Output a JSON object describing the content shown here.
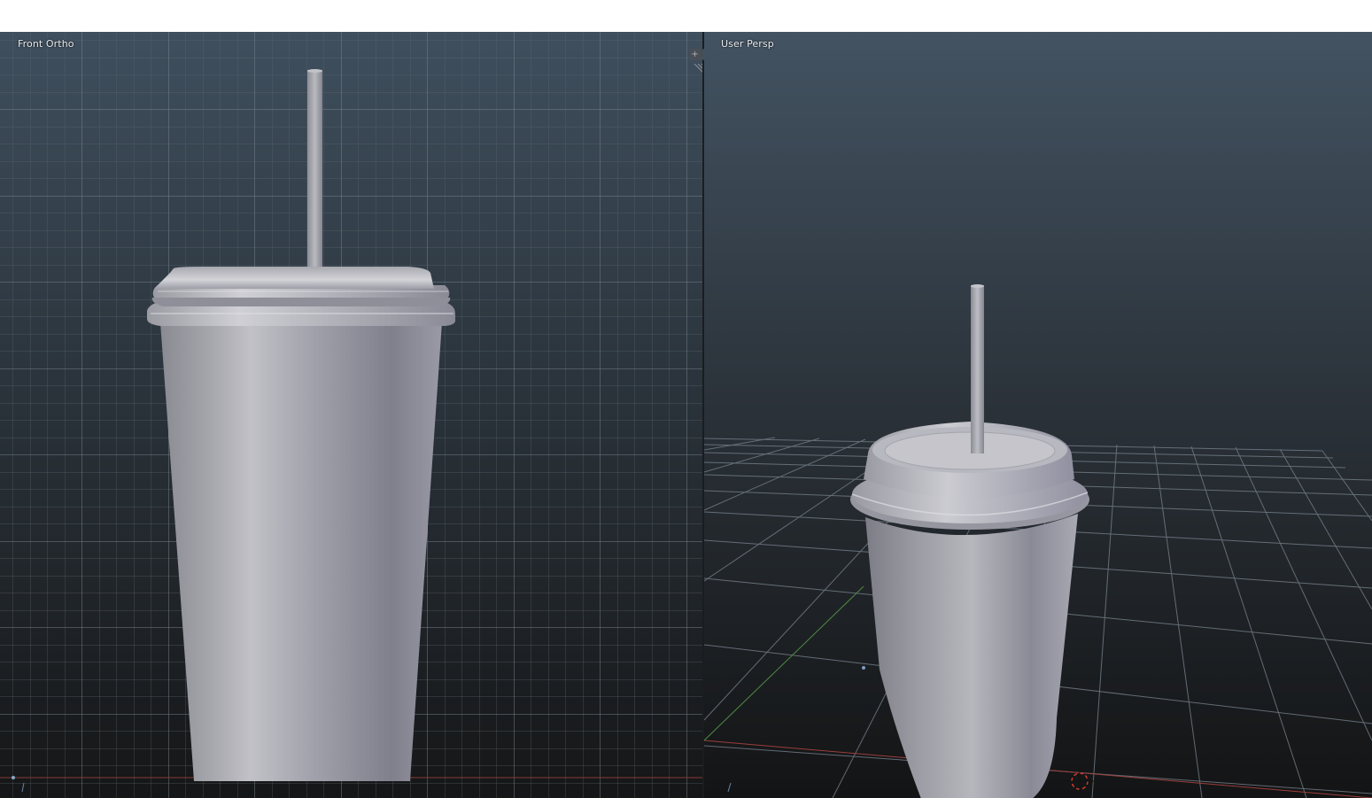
{
  "viewports": {
    "left": {
      "label": "Front Ortho"
    },
    "right": {
      "label": "User Persp"
    }
  },
  "split_widget": {
    "icons": [
      "plus-icon",
      "plus-icon"
    ],
    "glyph": "+"
  },
  "colors": {
    "bg_top": "#3e4e5e",
    "bg_bottom": "#141516",
    "grid_line": "#6e7780",
    "object_light": "#c6c6cc",
    "object_dark": "#74747f",
    "x_axis": "#b0413e",
    "y_axis": "#5d9c4a",
    "cursor": "#d43b2e"
  },
  "scene": {
    "object": "cup-with-lid-and-straw"
  }
}
